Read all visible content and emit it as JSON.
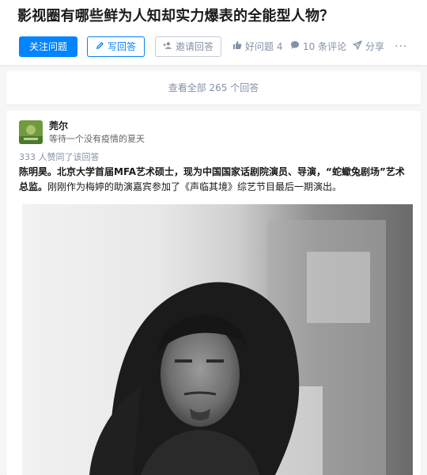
{
  "question": {
    "title": "影视圈有哪些鲜为人知却实力爆表的全能型人物？"
  },
  "actions": {
    "follow_label": "关注问题",
    "write_label": "写回答",
    "invite_label": "邀请回答",
    "good_question_label": "好问题 4",
    "comments_label": "10 条评论",
    "share_label": "分享",
    "more_label": "···"
  },
  "view_all": {
    "label": "查看全部 265 个回答"
  },
  "answer": {
    "author_name": "莞尔",
    "author_bio": "等待一个没有疫情的夏天",
    "votes_text": "333 人赞同了该回答",
    "bold_text": "陈明昊。北京大学首届MFA艺术硕士，现为中国国家话剧院演员、导演，“蛇蠍兔剧场”艺术总监。",
    "plain_text": "刚刚作为梅婷的助演嘉宾参加了《声临其境》综艺节目最后一期演出。"
  },
  "colors": {
    "brand_blue": "#0084ff",
    "muted_gray": "#8590a6",
    "page_bg": "#f6f6f6"
  },
  "icons": {
    "write": "pencil-icon",
    "invite": "add-user-icon",
    "good": "thumbs-up-icon",
    "comment": "speech-bubble-icon",
    "share": "paper-plane-icon"
  }
}
